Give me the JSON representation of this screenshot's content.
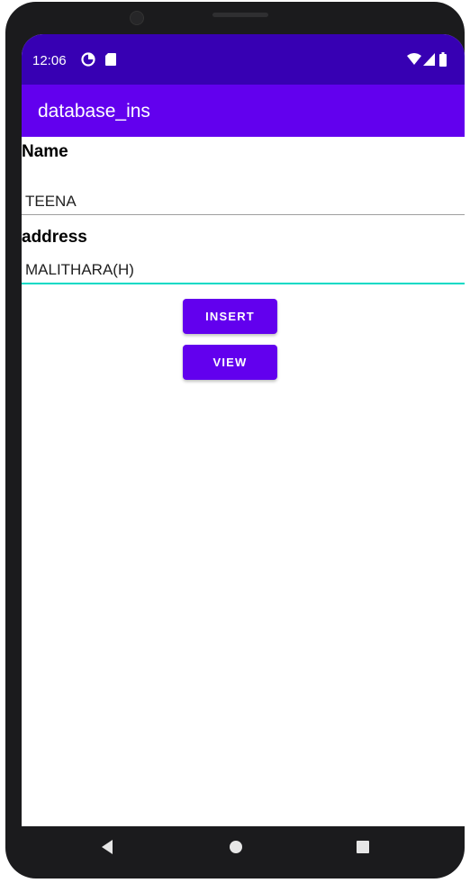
{
  "status_bar": {
    "time": "12:06",
    "left_icons": [
      "data-saver-icon",
      "sd-card-icon"
    ],
    "right_icons": [
      "wifi-icon",
      "signal-icon",
      "battery-icon"
    ]
  },
  "app_bar": {
    "title": "database_ins"
  },
  "form": {
    "name_label": "Name",
    "name_value": "TEENA",
    "address_label": "address",
    "address_value": "MALITHARA(H)"
  },
  "buttons": {
    "insert": "INSERT",
    "view": "VIEW"
  },
  "nav": {
    "back": "back-icon",
    "home": "home-icon",
    "recents": "recents-icon"
  },
  "colors": {
    "status_bar": "#3700b3",
    "primary": "#6200ee",
    "accent": "#03dac5"
  }
}
